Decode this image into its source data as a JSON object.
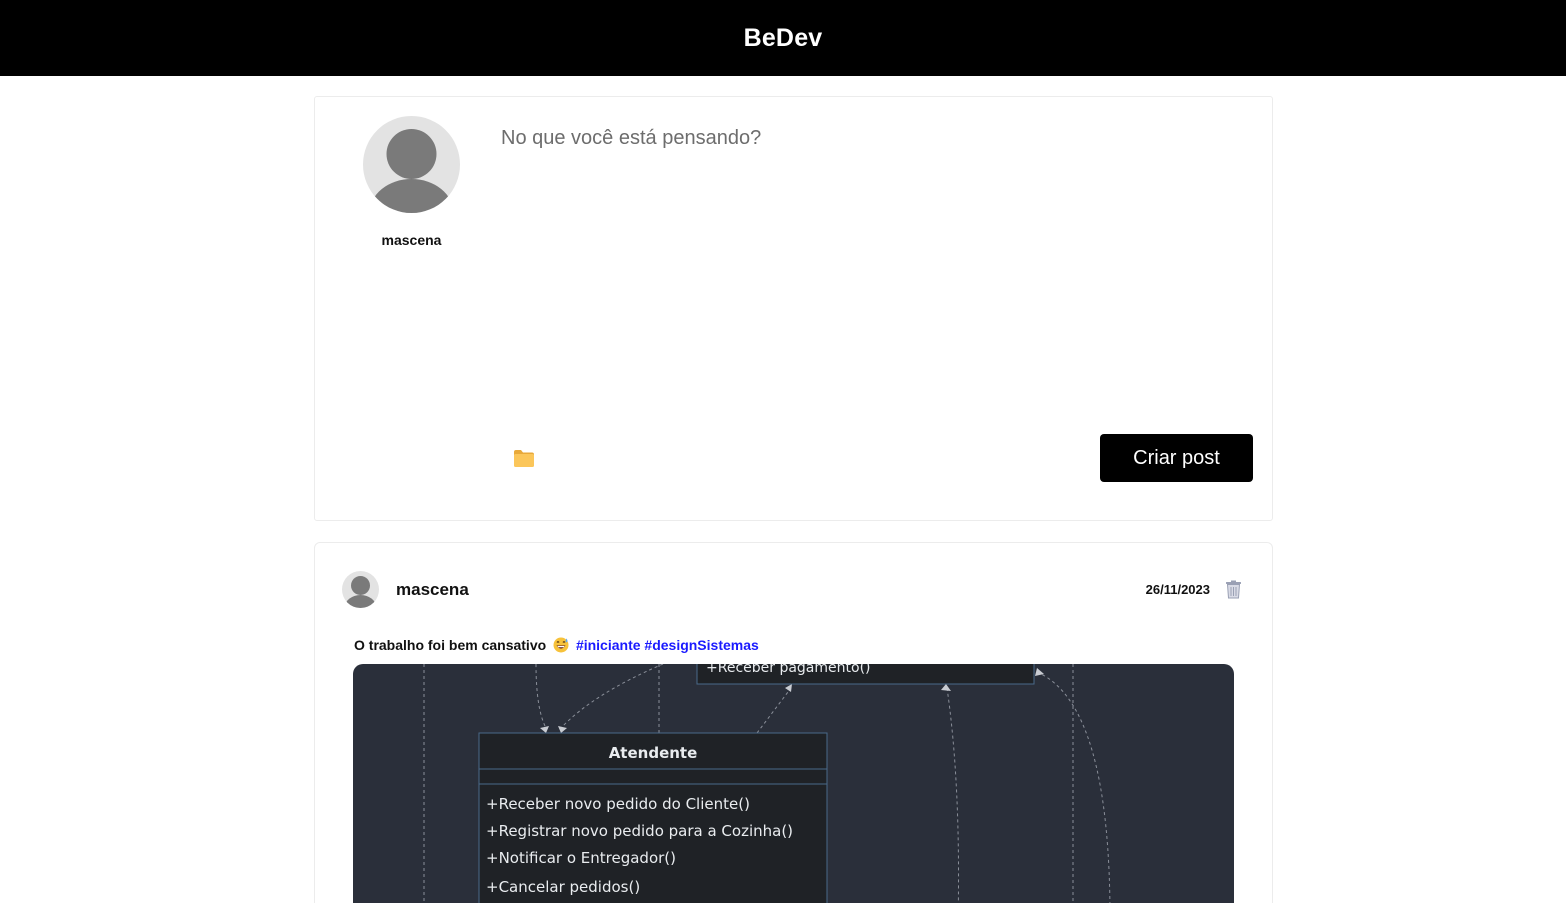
{
  "app": {
    "brand": "BeDev"
  },
  "composer": {
    "username": "mascena",
    "placeholder": "No que você está pensando?",
    "attach_icon": "folder-icon",
    "submit_label": "Criar post"
  },
  "post": {
    "author": "mascena",
    "date": "26/11/2023",
    "text": "O trabalho foi bem cansativo",
    "emoji": "grinning-sweat-emoji",
    "hashtags": "#iniciante #designSistemas",
    "delete_icon": "trash-icon",
    "image": {
      "top_method": "+Receber pagamento()",
      "class_name": "Atendente",
      "methods": [
        "+Receber novo pedido do Cliente()",
        "+Registrar novo pedido para a Cozinha()",
        "+Notificar o Entregador()",
        "+Cancelar pedidos()"
      ]
    }
  },
  "colors": {
    "topbar": "#000000",
    "hashtag": "#1a1aff",
    "diagram_bg": "#2a2f3a"
  }
}
